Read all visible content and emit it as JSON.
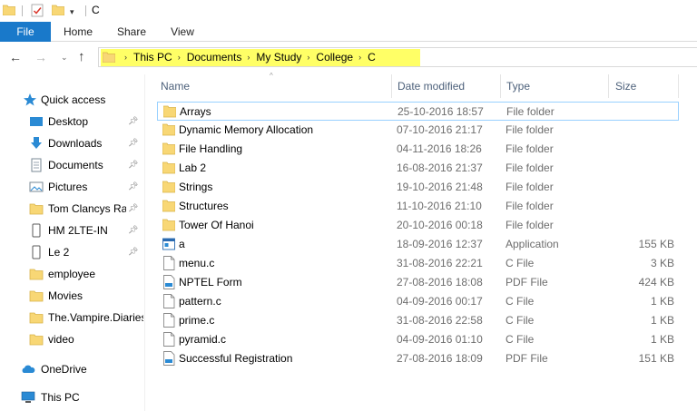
{
  "window": {
    "title": "C"
  },
  "ribbon": {
    "tabs": [
      "File",
      "Home",
      "Share",
      "View"
    ]
  },
  "address": {
    "crumbs": [
      "This PC",
      "Documents",
      "My Study",
      "College",
      "C"
    ]
  },
  "sidebar": {
    "items": [
      {
        "label": "Quick access",
        "icon": "star-icon",
        "pinned": false
      },
      {
        "label": "Desktop",
        "icon": "desktop-icon",
        "pinned": true
      },
      {
        "label": "Downloads",
        "icon": "download-icon",
        "pinned": true
      },
      {
        "label": "Documents",
        "icon": "documents-icon",
        "pinned": true
      },
      {
        "label": "Pictures",
        "icon": "pictures-icon",
        "pinned": true
      },
      {
        "label": "Tom Clancys Rai",
        "icon": "folder-icon",
        "pinned": true
      },
      {
        "label": "HM 2LTE-IN",
        "icon": "phone-icon",
        "pinned": true
      },
      {
        "label": "Le 2",
        "icon": "phone-icon",
        "pinned": true
      },
      {
        "label": "employee",
        "icon": "folder-icon",
        "pinned": false
      },
      {
        "label": "Movies",
        "icon": "folder-icon",
        "pinned": false
      },
      {
        "label": "The.Vampire.Diaries",
        "icon": "folder-icon",
        "pinned": false
      },
      {
        "label": "video",
        "icon": "folder-icon",
        "pinned": false
      },
      {
        "label": "OneDrive",
        "icon": "onedrive-icon",
        "pinned": false
      },
      {
        "label": "This PC",
        "icon": "this-pc-icon",
        "pinned": false
      }
    ]
  },
  "columns": {
    "name": "Name",
    "date": "Date modified",
    "type": "Type",
    "size": "Size"
  },
  "files": [
    {
      "name": "Arrays",
      "date": "25-10-2016 18:57",
      "type": "File folder",
      "size": "",
      "icon": "folder-icon",
      "selected": true
    },
    {
      "name": "Dynamic Memory Allocation",
      "date": "07-10-2016 21:17",
      "type": "File folder",
      "size": "",
      "icon": "folder-icon"
    },
    {
      "name": "File Handling",
      "date": "04-11-2016 18:26",
      "type": "File folder",
      "size": "",
      "icon": "folder-icon"
    },
    {
      "name": "Lab 2",
      "date": "16-08-2016 21:37",
      "type": "File folder",
      "size": "",
      "icon": "folder-icon"
    },
    {
      "name": "Strings",
      "date": "19-10-2016 21:48",
      "type": "File folder",
      "size": "",
      "icon": "folder-icon"
    },
    {
      "name": "Structures",
      "date": "11-10-2016 21:10",
      "type": "File folder",
      "size": "",
      "icon": "folder-icon"
    },
    {
      "name": "Tower Of Hanoi",
      "date": "20-10-2016 00:18",
      "type": "File folder",
      "size": "",
      "icon": "folder-icon"
    },
    {
      "name": "a",
      "date": "18-09-2016 12:37",
      "type": "Application",
      "size": "155 KB",
      "icon": "application-icon"
    },
    {
      "name": "menu.c",
      "date": "31-08-2016 22:21",
      "type": "C File",
      "size": "3 KB",
      "icon": "file-icon"
    },
    {
      "name": "NPTEL Form",
      "date": "27-08-2016 18:08",
      "type": "PDF File",
      "size": "424 KB",
      "icon": "pdf-icon"
    },
    {
      "name": "pattern.c",
      "date": "04-09-2016 00:17",
      "type": "C File",
      "size": "1 KB",
      "icon": "file-icon"
    },
    {
      "name": "prime.c",
      "date": "31-08-2016 22:58",
      "type": "C File",
      "size": "1 KB",
      "icon": "file-icon"
    },
    {
      "name": "pyramid.c",
      "date": "04-09-2016 01:10",
      "type": "C File",
      "size": "1 KB",
      "icon": "file-icon"
    },
    {
      "name": "Successful Registration",
      "date": "27-08-2016 18:09",
      "type": "PDF File",
      "size": "151 KB",
      "icon": "pdf-icon"
    }
  ],
  "colors": {
    "accent": "#1979ca",
    "folder": "#f8d775",
    "highlight": "#ffff66",
    "selection_border": "#99d1ff",
    "header_text": "#4c607a"
  }
}
